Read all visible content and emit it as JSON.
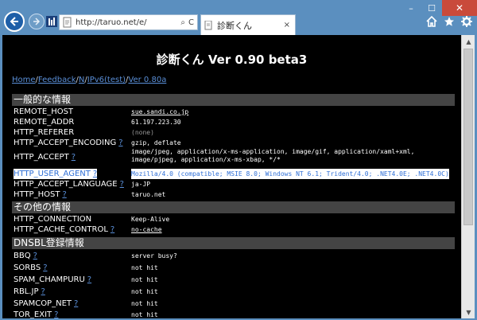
{
  "browser": {
    "address": "http://taruo.net/e/",
    "tab_label": "診断くん",
    "tab_close": "×",
    "window_buttons": [
      "–",
      "☐",
      "✕"
    ],
    "address_refresh": "C",
    "address_search": "⌕"
  },
  "page": {
    "title": "診断くん Ver 0.90 beta3",
    "crumbs": [
      "Home",
      "Feedback",
      "N",
      "IPv6(test)",
      "Ver 0.80a"
    ],
    "sections": {
      "general": "一般的な情報",
      "other": "その他の情報",
      "dnsbl": "DNSBL登録情報"
    },
    "q": "?",
    "rows": [
      {
        "k": "REMOTE_HOST",
        "v": "sue.sandi.co.jp"
      },
      {
        "k": "REMOTE_ADDR",
        "v": "61.197.223.30"
      },
      {
        "k": "HTTP_REFERER",
        "v": "(none)"
      },
      {
        "k": "HTTP_ACCEPT_ENCODING",
        "v": "gzip, deflate"
      },
      {
        "k": "HTTP_ACCEPT",
        "v": "image/jpeg, application/x-ms-application, image/gif, application/xaml+xml, image/pjpeg, application/x-ms-xbap, */*"
      },
      {
        "k": "HTTP_USER_AGENT",
        "v": "Mozilla/4.0 (compatible; MSIE 8.0; Windows NT 6.1; Trident/4.0; .NET4.0E; .NET4.0C)"
      },
      {
        "k": "HTTP_ACCEPT_LANGUAGE",
        "v": "ja-JP"
      },
      {
        "k": "HTTP_HOST",
        "v": "taruo.net"
      },
      {
        "k": "HTTP_CONNECTION",
        "v": "Keep-Alive"
      },
      {
        "k": "HTTP_CACHE_CONTROL",
        "v": "no-cache"
      },
      {
        "k": "BBQ",
        "v": "server busy?"
      },
      {
        "k": "SORBS",
        "v": "not hit"
      },
      {
        "k": "SPAM_CHAMPURU",
        "v": "not hit"
      },
      {
        "k": "RBL.JP",
        "v": "not hit"
      },
      {
        "k": "SPAMCOP_NET",
        "v": "not hit"
      },
      {
        "k": "TOR_EXIT",
        "v": "not hit"
      }
    ]
  }
}
